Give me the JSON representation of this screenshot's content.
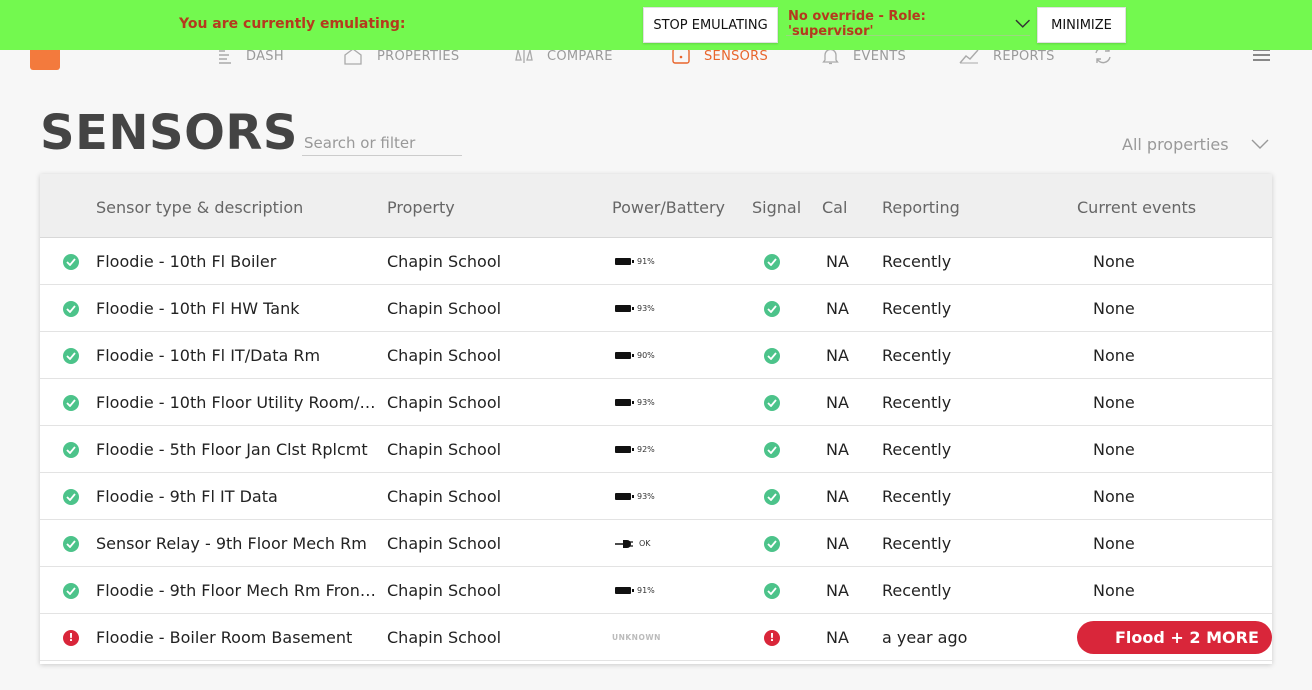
{
  "emulation": {
    "message": "You are currently emulating:",
    "stop_label": "STOP EMULATING",
    "role_override": "No override - Role: 'supervisor'",
    "minimize_label": "MINIMIZE"
  },
  "nav": {
    "items": [
      {
        "label": "DASH",
        "icon": "dash-icon"
      },
      {
        "label": "PROPERTIES",
        "icon": "house-icon"
      },
      {
        "label": "COMPARE",
        "icon": "compare-icon"
      },
      {
        "label": "SENSORS",
        "icon": "sensor-icon",
        "active": true
      },
      {
        "label": "EVENTS",
        "icon": "bell-icon"
      },
      {
        "label": "REPORTS",
        "icon": "chart-icon"
      }
    ]
  },
  "page": {
    "title": "SENSORS",
    "search_placeholder": "Search or filter",
    "property_filter": "All properties"
  },
  "table": {
    "headers": {
      "description": "Sensor type & description",
      "property": "Property",
      "power": "Power/Battery",
      "signal": "Signal",
      "cal": "Cal",
      "reporting": "Reporting",
      "events": "Current events"
    },
    "rows": [
      {
        "status": "ok",
        "description": "Floodie - 10th Fl Boiler",
        "property": "Chapin School",
        "power_type": "battery",
        "power": "91%",
        "signal": "ok",
        "cal": "NA",
        "reporting": "Recently",
        "events": "None"
      },
      {
        "status": "ok",
        "description": "Floodie - 10th Fl HW Tank",
        "property": "Chapin School",
        "power_type": "battery",
        "power": "93%",
        "signal": "ok",
        "cal": "NA",
        "reporting": "Recently",
        "events": "None"
      },
      {
        "status": "ok",
        "description": "Floodie - 10th Fl IT/Data Rm",
        "property": "Chapin School",
        "power_type": "battery",
        "power": "90%",
        "signal": "ok",
        "cal": "NA",
        "reporting": "Recently",
        "events": "None"
      },
      {
        "status": "ok",
        "description": "Floodie - 10th Floor Utility Room/La...",
        "property": "Chapin School",
        "power_type": "battery",
        "power": "93%",
        "signal": "ok",
        "cal": "NA",
        "reporting": "Recently",
        "events": "None"
      },
      {
        "status": "ok",
        "description": "Floodie - 5th Floor Jan Clst Rplcmt",
        "property": "Chapin School",
        "power_type": "battery",
        "power": "92%",
        "signal": "ok",
        "cal": "NA",
        "reporting": "Recently",
        "events": "None"
      },
      {
        "status": "ok",
        "description": "Floodie - 9th Fl IT Data",
        "property": "Chapin School",
        "power_type": "battery",
        "power": "93%",
        "signal": "ok",
        "cal": "NA",
        "reporting": "Recently",
        "events": "None"
      },
      {
        "status": "ok",
        "description": "Sensor Relay - 9th Floor Mech Rm",
        "property": "Chapin School",
        "power_type": "plug",
        "power": "OK",
        "signal": "ok",
        "cal": "NA",
        "reporting": "Recently",
        "events": "None"
      },
      {
        "status": "ok",
        "description": "Floodie - 9th Floor Mech Rm Front ...",
        "property": "Chapin School",
        "power_type": "battery",
        "power": "91%",
        "signal": "ok",
        "cal": "NA",
        "reporting": "Recently",
        "events": "None"
      },
      {
        "status": "err",
        "description": "Floodie - Boiler Room Basement",
        "property": "Chapin School",
        "power_type": "unknown",
        "power": "UNKNOWN",
        "signal": "err",
        "cal": "NA",
        "reporting": "a year ago",
        "events": "Flood + 2 MORE"
      }
    ]
  },
  "colors": {
    "emulation_bar": "#73f94f",
    "accent": "#e8652c",
    "ok": "#4cc38a",
    "alert": "#d9263a"
  }
}
